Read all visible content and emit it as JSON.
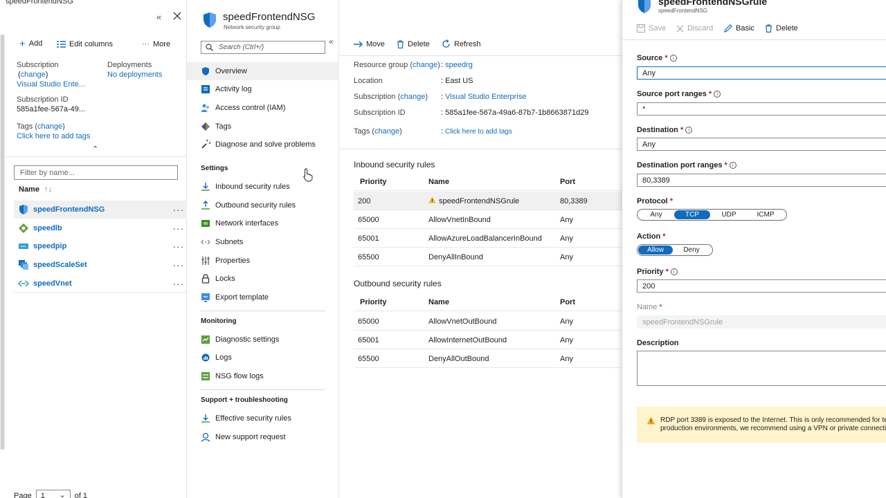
{
  "breadcrumb": "speedFrontendNSG",
  "left_blade": {
    "toolbar": {
      "add": "Add",
      "edit_columns": "Edit columns",
      "more": "More"
    },
    "subscription_label": "Subscription",
    "change_link": "change",
    "subscription_value": "Visual Studio Ente...",
    "deployments_label": "Deployments",
    "deployments_value": "No deployments",
    "subscription_id_label": "Subscription ID",
    "subscription_id_value": "585a1fee-567a-49...",
    "tags_label": "Tags",
    "tags_link": "Click here to add tags",
    "filter_placeholder": "Filter by name...",
    "name_column": "Name",
    "resources": [
      {
        "name": "speedFrontendNSG",
        "icon": "shield-icon"
      },
      {
        "name": "speedlb",
        "icon": "load-balancer-icon"
      },
      {
        "name": "speedpip",
        "icon": "public-ip-icon"
      },
      {
        "name": "speedScaleSet",
        "icon": "scale-set-icon"
      },
      {
        "name": "speedVnet",
        "icon": "vnet-icon"
      }
    ],
    "pagination": {
      "page_label": "Page",
      "page_value": "1",
      "of_label": "of 1"
    }
  },
  "header": {
    "title": "speedFrontendNSG",
    "subtitle": "Network security group"
  },
  "nav": {
    "search_placeholder": "Search (Ctrl+/)",
    "items_top": [
      "Overview",
      "Activity log",
      "Access control (IAM)",
      "Tags",
      "Diagnose and solve problems"
    ],
    "settings_header": "Settings",
    "settings_items": [
      "Inbound security rules",
      "Outbound security rules",
      "Network interfaces",
      "Subnets",
      "Properties",
      "Locks",
      "Export template"
    ],
    "monitoring_header": "Monitoring",
    "monitoring_items": [
      "Diagnostic settings",
      "Logs",
      "NSG flow logs"
    ],
    "support_header": "Support + troubleshooting",
    "support_items": [
      "Effective security rules",
      "New support request"
    ]
  },
  "main": {
    "toolbar": {
      "move": "Move",
      "delete": "Delete",
      "refresh": "Refresh"
    },
    "essentials": {
      "resource_group_label": "Resource group",
      "resource_group_value": "speedrg",
      "location_label": "Location",
      "location_value": "East US",
      "subscription_label": "Subscription",
      "subscription_value": "Visual Studio Enterprise",
      "subscription_id_label": "Subscription ID",
      "subscription_id_value": "585a1fee-567a-49a6-87b7-1b8663871d29",
      "tags_label": "Tags",
      "tags_value": "Click here to add tags",
      "change": "change",
      "colon": ":"
    },
    "inbound_title": "Inbound security rules",
    "outbound_title": "Outbound security rules",
    "columns": {
      "priority": "Priority",
      "name": "Name",
      "port": "Port"
    },
    "inbound_rules": [
      {
        "priority": "200",
        "name": "speedFrontendNSGrule",
        "port": "80,3389",
        "warning": true
      },
      {
        "priority": "65000",
        "name": "AllowVnetInBound",
        "port": "Any"
      },
      {
        "priority": "65001",
        "name": "AllowAzureLoadBalancerInBound",
        "port": "Any"
      },
      {
        "priority": "65500",
        "name": "DenyAllInBound",
        "port": "Any"
      }
    ],
    "outbound_rules": [
      {
        "priority": "65000",
        "name": "AllowVnetOutBound",
        "port": "Any"
      },
      {
        "priority": "65001",
        "name": "AllowInternetOutBound",
        "port": "Any"
      },
      {
        "priority": "65500",
        "name": "DenyAllOutBound",
        "port": "Any"
      }
    ]
  },
  "edit": {
    "title": "speedFrontendNSGrule",
    "subtitle": "speedFrontendNSG",
    "toolbar": {
      "save": "Save",
      "discard": "Discard",
      "basic": "Basic",
      "delete": "Delete"
    },
    "source_label": "Source",
    "source_value": "Any",
    "source_port_label": "Source port ranges",
    "source_port_value": "*",
    "destination_label": "Destination",
    "destination_value": "Any",
    "destination_port_label": "Destination port ranges",
    "destination_port_value": "80,3389",
    "protocol_label": "Protocol",
    "protocol_options": [
      "Any",
      "TCP",
      "UDP",
      "ICMP"
    ],
    "protocol_selected": "TCP",
    "action_label": "Action",
    "action_options": [
      "Allow",
      "Deny"
    ],
    "action_selected": "Allow",
    "priority_label": "Priority",
    "priority_value": "200",
    "name_label": "Name",
    "name_value": "speedFrontendNSGrule",
    "description_label": "Description",
    "description_value": "",
    "required_mark": "*",
    "warning_line1": "RDP port 3389 is exposed to the Internet. This is only recommended for te",
    "warning_line2": "production environments, we recommend using a VPN or private connecti"
  },
  "colors": {
    "accent": "#0f6cbd",
    "warning": "#f2b01e",
    "selected_bg": "#f0f0f0"
  }
}
